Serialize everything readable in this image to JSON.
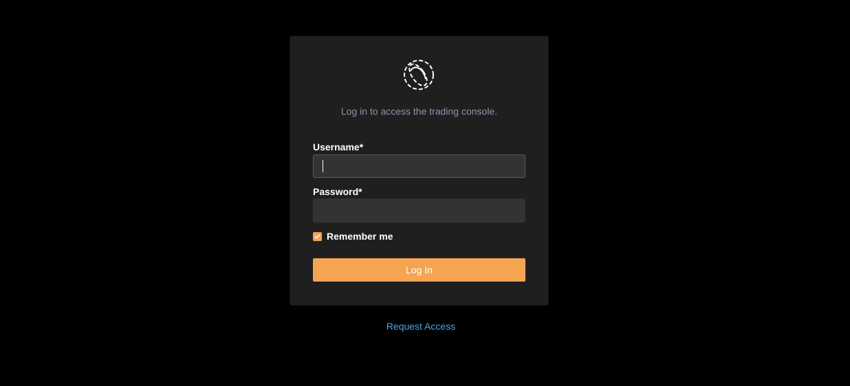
{
  "login": {
    "subtitle": "Log in to access the trading console.",
    "username_label": "Username*",
    "username_value": "",
    "password_label": "Password*",
    "password_value": "",
    "remember_label": "Remember me",
    "remember_checked": true,
    "login_button": "Log In"
  },
  "footer": {
    "request_access": "Request Access"
  },
  "icons": {
    "logo": "dashed-ring-logo-icon",
    "checkbox": "checkmark-icon"
  },
  "colors": {
    "background": "#000000",
    "card": "#1f1f1f",
    "input": "#333333",
    "accent": "#f5a452",
    "link": "#4ea6e4",
    "subtitle": "#8a97ad"
  }
}
